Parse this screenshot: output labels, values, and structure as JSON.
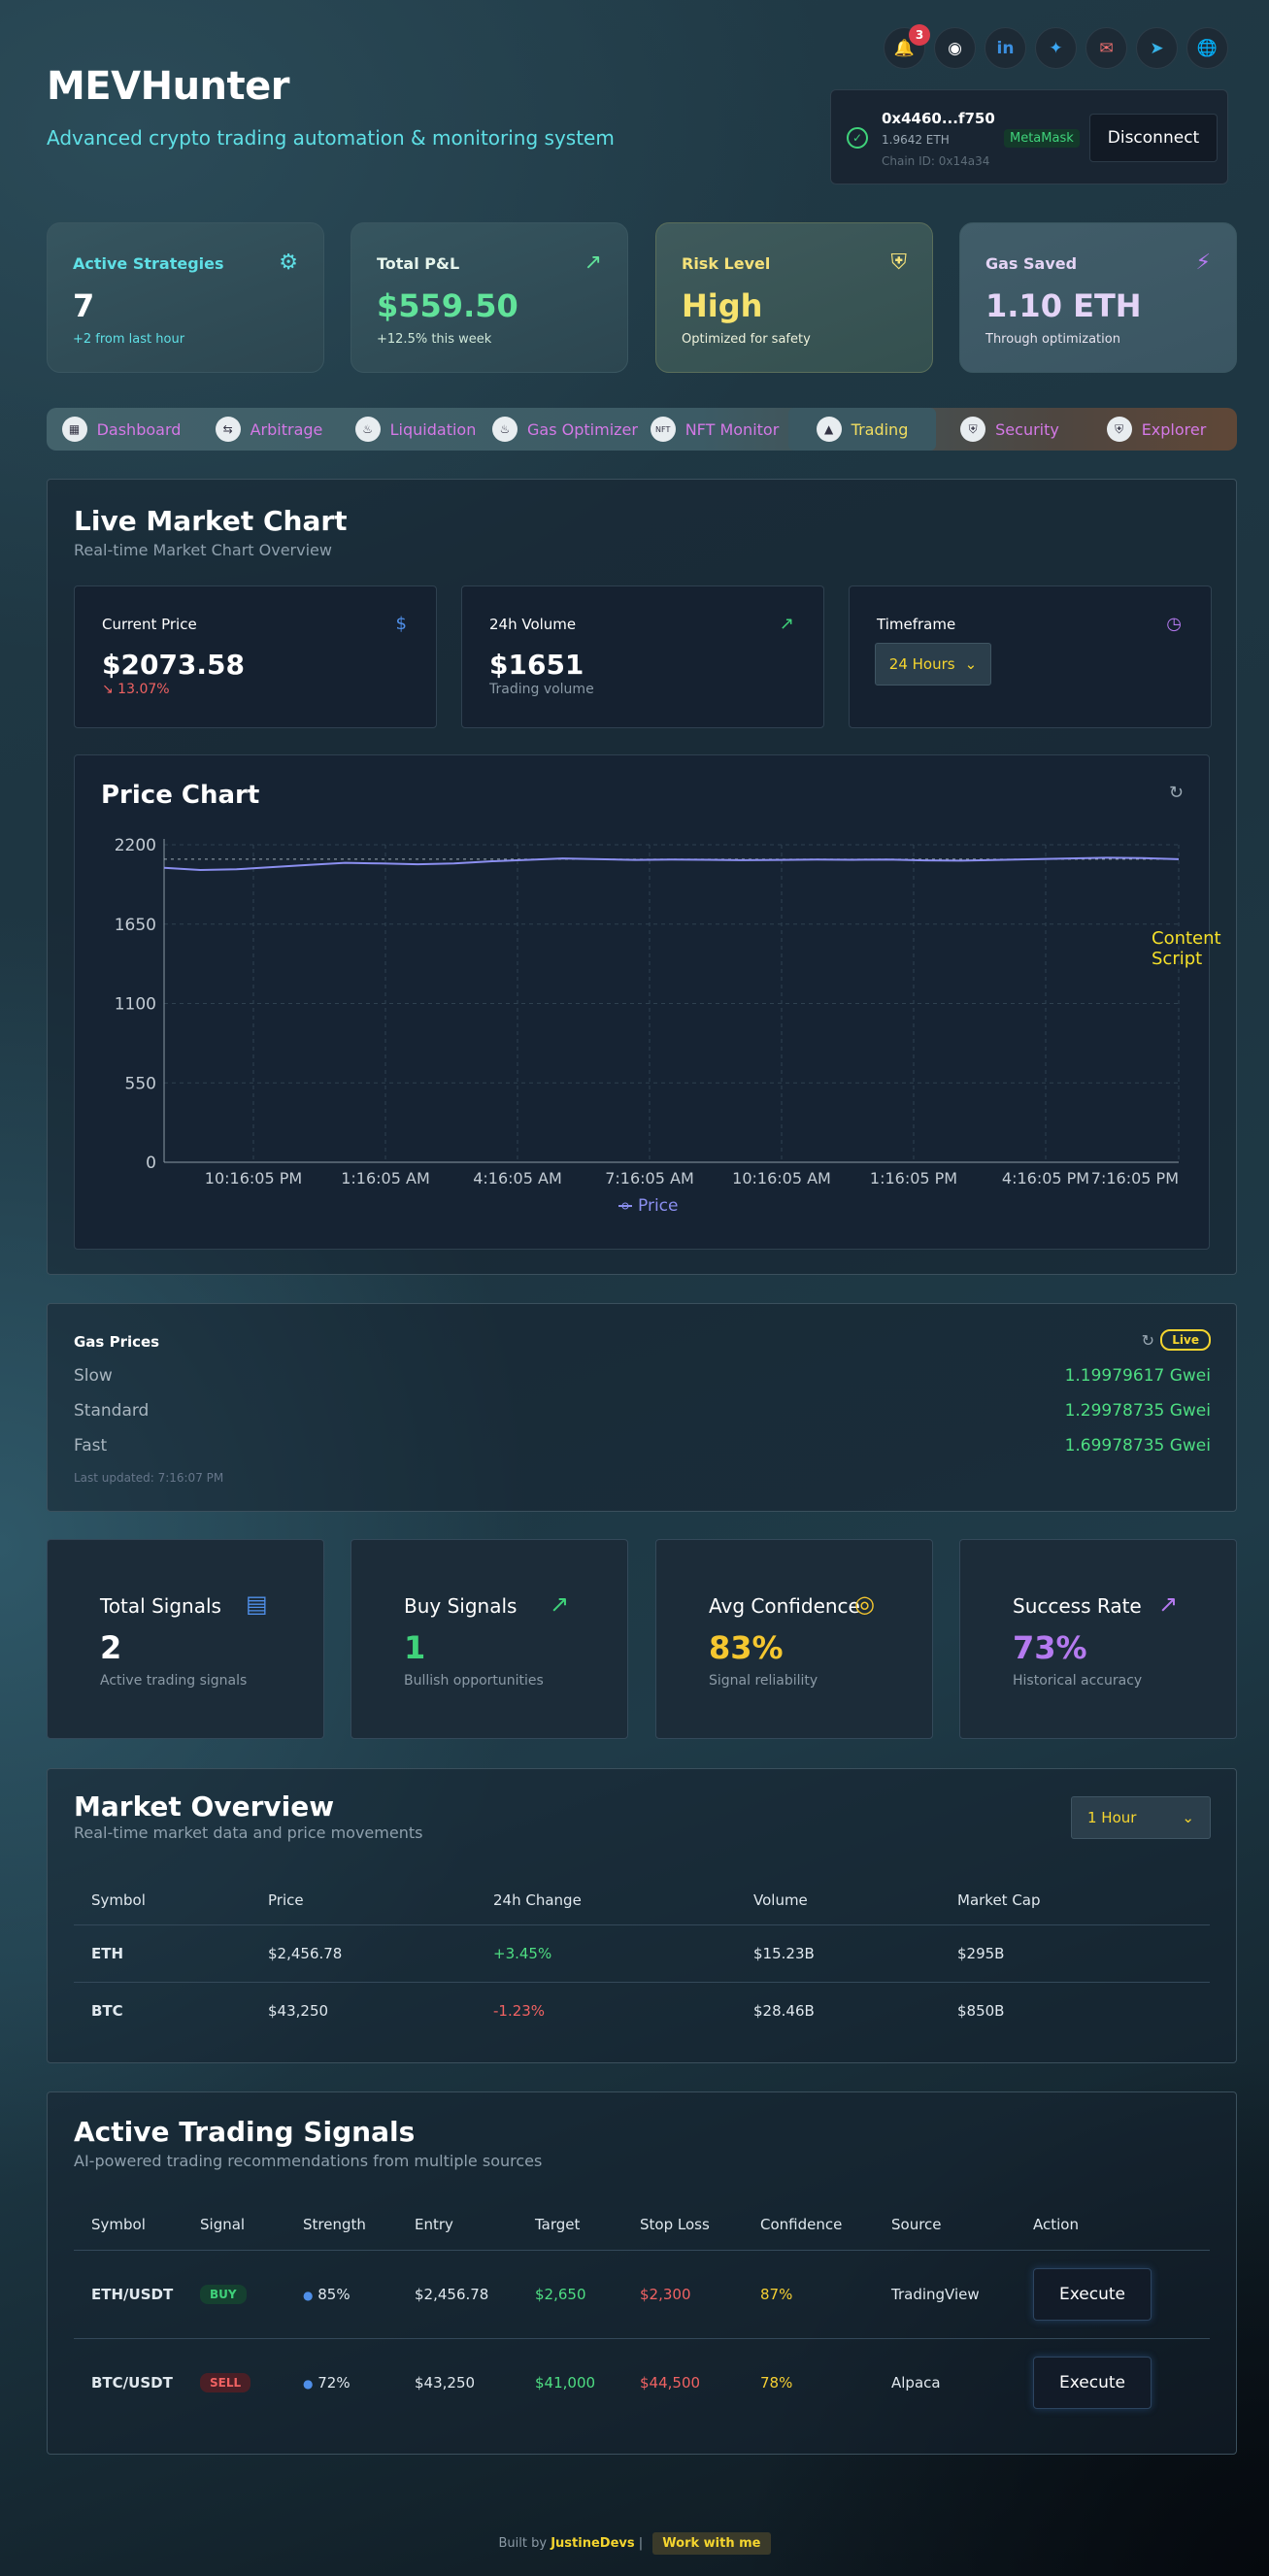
{
  "header": {
    "title": "MEVHunter",
    "subtitle": "Advanced crypto trading automation & monitoring system",
    "notification_count": "3",
    "socials": [
      {
        "icon": "bell-icon",
        "color": "#f5c542"
      },
      {
        "icon": "github-icon",
        "color": "#ffffff"
      },
      {
        "icon": "linkedin-icon",
        "color": "#3b8fe0"
      },
      {
        "icon": "twitter-icon",
        "color": "#3ba6f2"
      },
      {
        "icon": "mail-icon",
        "color": "#f07070"
      },
      {
        "icon": "telegram-icon",
        "color": "#37b3e8"
      },
      {
        "icon": "globe-icon",
        "color": "#3fd27a"
      }
    ]
  },
  "wallet": {
    "address": "0x4460...f750",
    "balance": "1.9642 ETH",
    "chain": "Chain ID: 0x14a34",
    "provider": "MetaMask",
    "disconnect_label": "Disconnect"
  },
  "stats": [
    {
      "title": "Active Strategies",
      "value": "7",
      "sub": "+2 from last hour",
      "icon": "robot-icon",
      "title_color": "#5fe0e6",
      "value_color": "#ffffff",
      "sub_color": "#5fe0e6"
    },
    {
      "title": "Total P&L",
      "value": "$559.50",
      "sub": "+12.5% this week",
      "icon": "trend-up-icon",
      "title_color": "#e6f5ec",
      "value_color": "#61e39a",
      "sub_color": "#cfe8d9"
    },
    {
      "title": "Risk Level",
      "value": "High",
      "sub": "Optimized for safety",
      "icon": "shield-icon",
      "title_color": "#f5e27a",
      "value_color": "#f7e36d",
      "sub_color": "#eef2dc"
    },
    {
      "title": "Gas Saved",
      "value": "1.10 ETH",
      "sub": "Through optimization",
      "icon": "bolt-icon",
      "title_color": "#e4d4f5",
      "value_color": "#e4d4f7",
      "sub_color": "#e6e2ee"
    }
  ],
  "nav": [
    {
      "label": "Dashboard",
      "icon": "dashboard-icon"
    },
    {
      "label": "Arbitrage",
      "icon": "arbitrage-icon"
    },
    {
      "label": "Liquidation",
      "icon": "liquidation-icon"
    },
    {
      "label": "Gas Optimizer",
      "icon": "gas-icon"
    },
    {
      "label": "NFT Monitor",
      "icon": "nft-icon"
    },
    {
      "label": "Trading",
      "icon": "trading-icon",
      "active": true
    },
    {
      "label": "Security",
      "icon": "security-icon"
    },
    {
      "label": "Explorer",
      "icon": "explorer-icon"
    }
  ],
  "live_market": {
    "title": "Live Market Chart",
    "subtitle": "Real-time Market Chart Overview",
    "current_price_label": "Current Price",
    "current_price": "$2073.58",
    "current_change": "↘ 13.07%",
    "volume_label": "24h Volume",
    "volume": "$1651",
    "volume_sub": "Trading volume",
    "timeframe_label": "Timeframe",
    "timeframe_value": "24 Hours",
    "chart_title": "Price Chart",
    "overlay_text": "Content Script"
  },
  "chart_data": {
    "type": "line",
    "title": "Price Chart",
    "x_ticks": [
      "10:16:05 PM",
      "1:16:05 AM",
      "4:16:05 AM",
      "7:16:05 AM",
      "10:16:05 AM",
      "1:16:05 PM",
      "4:16:05 PM",
      "7:16:05 PM"
    ],
    "y_ticks": [
      0,
      550,
      1100,
      1650,
      2200
    ],
    "ylim": [
      0,
      2200
    ],
    "grid": true,
    "legend": "bottom",
    "reference_line": 2100,
    "series": [
      {
        "name": "Price",
        "color": "#8b8ff0",
        "values": [
          2040,
          2025,
          2030,
          2045,
          2060,
          2075,
          2070,
          2065,
          2070,
          2085,
          2095,
          2105,
          2100,
          2095,
          2098,
          2096,
          2093,
          2095,
          2097,
          2096,
          2098,
          2092,
          2090,
          2095,
          2100,
          2105,
          2110,
          2108,
          2100
        ]
      }
    ]
  },
  "gas": {
    "title": "Gas Prices",
    "live_label": "Live",
    "rows": [
      {
        "label": "Slow",
        "value": "1.19979617 Gwei"
      },
      {
        "label": "Standard",
        "value": "1.29978735 Gwei"
      },
      {
        "label": "Fast",
        "value": "1.69978735 Gwei"
      }
    ],
    "updated": "Last updated: 7:16:07 PM"
  },
  "signal_stats": [
    {
      "title": "Total Signals",
      "value": "2",
      "sub": "Active trading signals",
      "icon": "bar-chart-icon",
      "value_color": "#ffffff",
      "icon_color": "#4f8fe8"
    },
    {
      "title": "Buy Signals",
      "value": "1",
      "sub": "Bullish opportunities",
      "icon": "trend-up-icon",
      "value_color": "#3fd27a",
      "icon_color": "#3fd27a"
    },
    {
      "title": "Avg Confidence",
      "value": "83%",
      "sub": "Signal reliability",
      "icon": "target-icon",
      "value_color": "#f5c72f",
      "icon_color": "#f5c72f"
    },
    {
      "title": "Success Rate",
      "value": "73%",
      "sub": "Historical accuracy",
      "icon": "trend-up-icon",
      "value_color": "#b57af0",
      "icon_color": "#b57af0"
    }
  ],
  "market_overview": {
    "title": "Market Overview",
    "subtitle": "Real-time market data and price movements",
    "interval": "1 Hour",
    "columns": [
      "Symbol",
      "Price",
      "24h Change",
      "Volume",
      "Market Cap"
    ],
    "rows": [
      {
        "symbol": "ETH",
        "price": "$2,456.78",
        "change": "+3.45%",
        "dir": "pos",
        "volume": "$15.23B",
        "cap": "$295B"
      },
      {
        "symbol": "BTC",
        "price": "$43,250",
        "change": "-1.23%",
        "dir": "neg",
        "volume": "$28.46B",
        "cap": "$850B"
      }
    ]
  },
  "signals": {
    "title": "Active Trading Signals",
    "subtitle": "AI-powered trading recommendations from multiple sources",
    "columns": [
      "Symbol",
      "Signal",
      "Strength",
      "Entry",
      "Target",
      "Stop Loss",
      "Confidence",
      "Source",
      "Action"
    ],
    "rows": [
      {
        "symbol": "ETH/USDT",
        "signal": "BUY",
        "dir": "pos",
        "strength": "85%",
        "entry": "$2,456.78",
        "target": "$2,650",
        "stop": "$2,300",
        "confidence": "87%",
        "source": "TradingView",
        "action": "Execute"
      },
      {
        "symbol": "BTC/USDT",
        "signal": "SELL",
        "dir": "neg",
        "strength": "72%",
        "entry": "$43,250",
        "target": "$41,000",
        "stop": "$44,500",
        "confidence": "78%",
        "source": "Alpaca",
        "action": "Execute"
      }
    ]
  },
  "footer": {
    "built_by": "Built by",
    "author": "JustineDevs",
    "separator": "|",
    "cta": "Work with me"
  }
}
